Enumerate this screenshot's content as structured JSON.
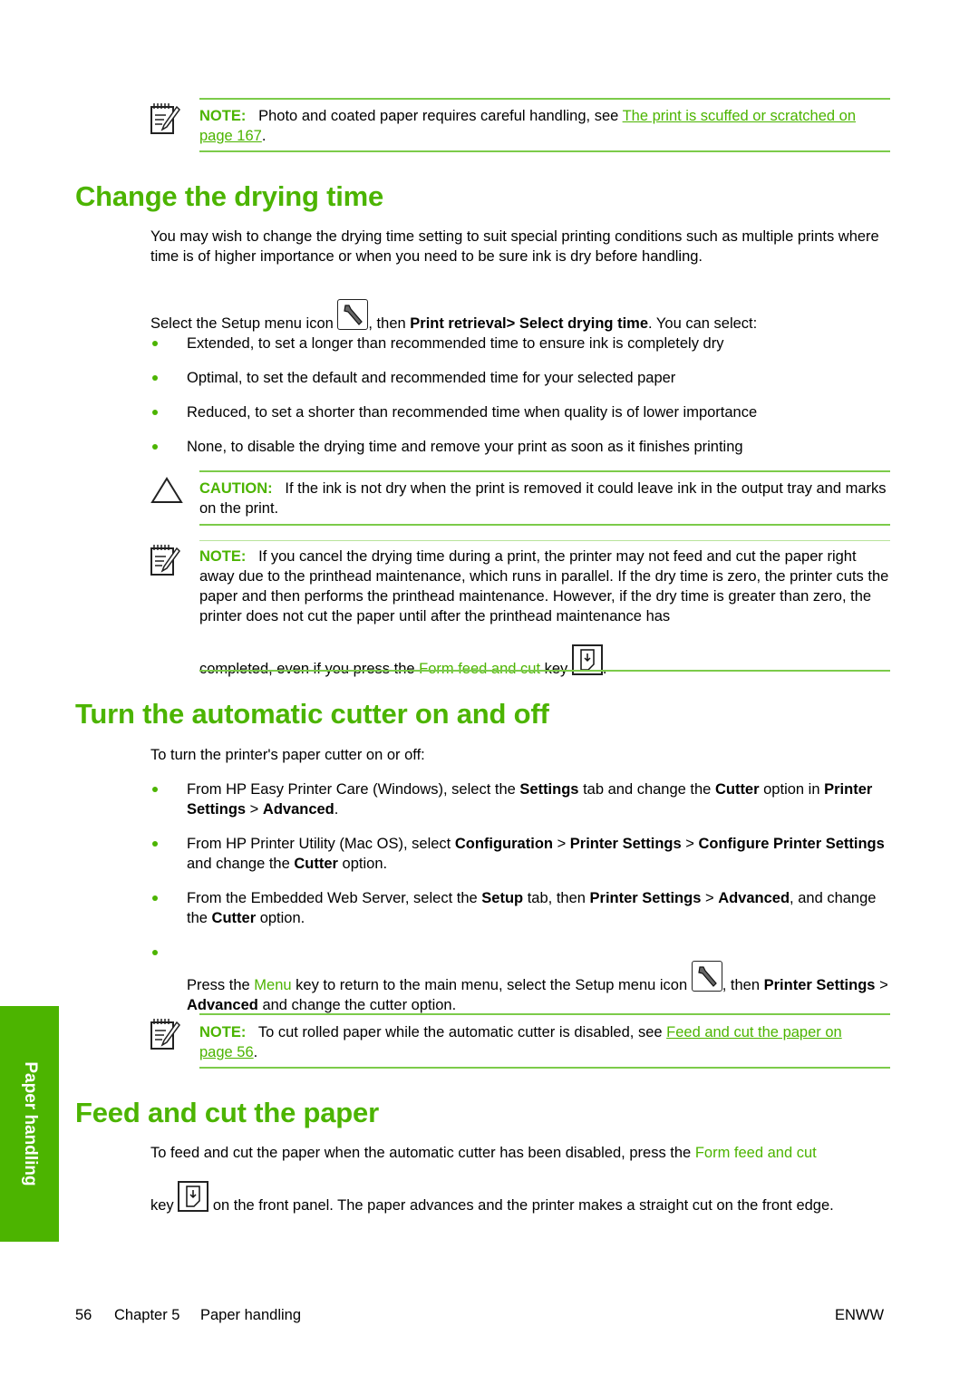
{
  "note1": {
    "label": "NOTE:",
    "text": "Photo and coated paper requires careful handling, see ",
    "link": "The print is scuffed or scratched on page 167",
    "end": "."
  },
  "section1": {
    "title": "Change the drying time",
    "intro": "You may wish to change the drying time setting to suit special printing conditions such as multiple prints where time is of higher importance or when you need to be sure ink is dry before handling.",
    "select_pre": "Select the Setup menu icon ",
    "select_mid": ", then ",
    "select_b1": "Print retrieval",
    "select_sep": "> ",
    "select_b2": "Select drying time",
    "select_post": ". You can select:",
    "options": [
      "Extended, to set a longer than recommended time to ensure ink is completely dry",
      "Optimal, to set the default and recommended time for your selected paper",
      "Reduced, to set a shorter than recommended time when quality is of lower importance",
      "None, to disable the drying time and remove your print as soon as it finishes printing"
    ],
    "caution": {
      "label": "CAUTION:",
      "text": "If the ink is not dry when the print is removed it could leave ink in the output tray and marks on the print."
    },
    "note": {
      "label": "NOTE:",
      "text": "If you cancel the drying time during a print, the printer may not feed and cut the paper right away due to the printhead maintenance, which runs in parallel. If the dry time is zero, the printer cuts the paper and then performs the printhead maintenance. However, if the dry time is greater than zero, the printer does not cut the paper until after the printhead maintenance has",
      "last_pre": "completed, even if you press the ",
      "last_key": "Form feed and cut",
      "last_post": " key ",
      "end": "."
    }
  },
  "section2": {
    "title": "Turn the automatic cutter on and off",
    "intro": "To turn the printer's paper cutter on or off:",
    "b1": {
      "t1": "From HP Easy Printer Care (Windows), select the ",
      "b1": "Settings",
      "t2": " tab and change the ",
      "b2": "Cutter",
      "t3": " option in ",
      "b3": "Printer Settings",
      "t4": " > ",
      "b4": "Advanced",
      "t5": "."
    },
    "b2": {
      "t1": "From HP Printer Utility (Mac OS), select ",
      "b1": "Configuration",
      "t2": " > ",
      "b2": "Printer Settings",
      "t3": " > ",
      "b3": "Configure Printer Settings",
      "t4": " and change the ",
      "b4": "Cutter",
      "t5": " option."
    },
    "b3": {
      "t1": "From the Embedded Web Server, select the ",
      "b1": "Setup",
      "t2": " tab, then ",
      "b2": "Printer Settings",
      "t3": " > ",
      "b3": "Advanced",
      "t4": ", and change the ",
      "b4": "Cutter",
      "t5": " option."
    },
    "b4": {
      "t1": "Press the ",
      "menu": "Menu",
      "t2": " key to return to the main menu, select the Setup menu icon ",
      "t3": ", then ",
      "b1": "Printer Settings",
      "t4": " > ",
      "b2": "Advanced",
      "t5": " and change the cutter option."
    },
    "note": {
      "label": "NOTE:",
      "text": "To cut rolled paper while the automatic cutter is disabled, see ",
      "link": "Feed and cut the paper on page 56",
      "end": "."
    }
  },
  "section3": {
    "title": "Feed and cut the paper",
    "t1": "To feed and cut the paper when the automatic cutter has been disabled, press the ",
    "key": "Form feed and cut",
    "t2": "key ",
    "t3": " on the front panel. The paper advances and the printer makes a straight cut on the front edge."
  },
  "sidetab": "Paper handling",
  "footer": {
    "page": "56",
    "chapter": "Chapter 5",
    "chapter_title": "Paper handling",
    "right": "ENWW"
  }
}
